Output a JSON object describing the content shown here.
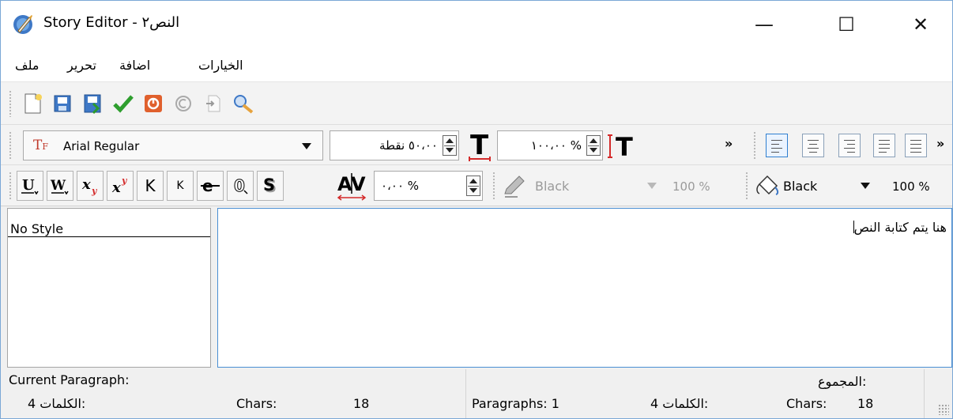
{
  "titlebar": {
    "title": "Story Editor - النص٢",
    "minimize": "—",
    "maximize": "☐",
    "close": "✕"
  },
  "menu": {
    "items": [
      "ملف",
      "تحرير",
      "اضافة",
      "الخيارات"
    ]
  },
  "toolbar": {
    "icons": [
      "new-document-icon",
      "open-icon",
      "save-icon",
      "check-icon",
      "stop-icon",
      "copyright-icon",
      "insert-icon",
      "find-replace-icon"
    ]
  },
  "format": {
    "font_name": "Arial Regular",
    "font_size": "٥٠،٠٠ نقطة",
    "scale_h": "١٠٠،٠٠ %",
    "tracking": "٠،٠٠ %",
    "more_indicator": "»",
    "fill_color": "Black",
    "fill_opacity": "100 %",
    "stroke_color": "Black",
    "stroke_opacity": "100 %"
  },
  "style_panel": {
    "items": [
      "No Style"
    ]
  },
  "editor": {
    "text": "هنا يتم كتابة النص"
  },
  "status": {
    "current_paragraph": "Current Paragraph:",
    "total": "المجموع:",
    "words_1": "4 الكلمات:",
    "chars_label_1": "Chars:",
    "chars_value_1": "18",
    "paragraphs": "Paragraphs: 1",
    "words_2": "4 الكلمات:",
    "chars_label_2": "Chars:",
    "chars_value_2": "18"
  },
  "colors": {
    "accent": "#2f7fd0",
    "border": "#7aa7d6"
  }
}
